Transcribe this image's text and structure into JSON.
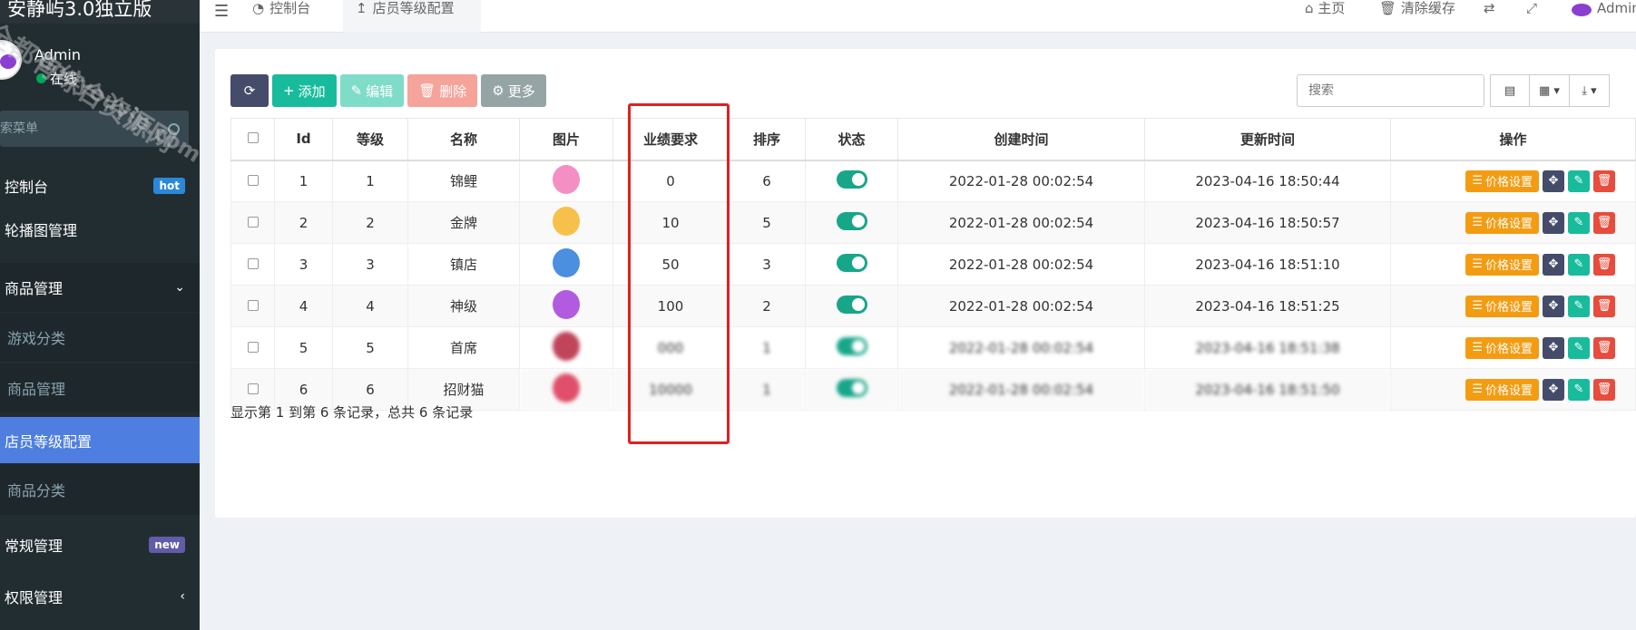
{
  "sidebar": {
    "brand": "安静屿3.0独立版",
    "user_name": "Admin",
    "user_status": "在线",
    "search_placeholder": "搜索菜单",
    "items": [
      {
        "label": "控制台",
        "badge": "hot"
      },
      {
        "label": "轮播图管理"
      },
      {
        "label": "商品管理"
      },
      {
        "label": "游戏分类"
      },
      {
        "label": "商品管理"
      },
      {
        "label": "店员等级配置"
      },
      {
        "label": "商品分类"
      },
      {
        "label": "常规管理",
        "badge": "new"
      },
      {
        "label": "权限管理"
      }
    ]
  },
  "watermark": {
    "line1": "全都有综合资源网",
    "line2": "douyouvip.com"
  },
  "header": {
    "menu_icon": "hamburger-icon",
    "tabs": [
      {
        "label": "控制台",
        "icon": "dashboard-icon"
      },
      {
        "label": "店员等级配置",
        "icon": "level-icon"
      }
    ],
    "home": "主页",
    "clear_cache": "清除缓存",
    "admin": "Admin"
  },
  "toolbar": {
    "refresh_icon": "refresh-icon",
    "add": "添加",
    "edit": "编辑",
    "delete": "删除",
    "more": "更多",
    "search_placeholder": "搜索"
  },
  "table": {
    "headers": [
      "Id",
      "等级",
      "名称",
      "图片",
      "业绩要求",
      "排序",
      "状态",
      "创建时间",
      "更新时间",
      "操作"
    ],
    "rows": [
      {
        "id": "1",
        "level": "1",
        "name": "锦鲤",
        "img_color": "#f48fc4",
        "requirement": "0",
        "sort": "6",
        "created": "2022-01-28 00:02:54",
        "updated": "2023-04-16 18:50:44"
      },
      {
        "id": "2",
        "level": "2",
        "name": "金牌",
        "img_color": "#f7c04a",
        "requirement": "10",
        "sort": "5",
        "created": "2022-01-28 00:02:54",
        "updated": "2023-04-16 18:50:57"
      },
      {
        "id": "3",
        "level": "3",
        "name": "镇店",
        "img_color": "#4a8fe0",
        "requirement": "50",
        "sort": "3",
        "created": "2022-01-28 00:02:54",
        "updated": "2023-04-16 18:51:10"
      },
      {
        "id": "4",
        "level": "4",
        "name": "神级",
        "img_color": "#b25be0",
        "requirement": "100",
        "sort": "2",
        "created": "2022-01-28 00:02:54",
        "updated": "2023-04-16 18:51:25"
      },
      {
        "id": "5",
        "level": "5",
        "name": "首席",
        "img_color": "#c0455a",
        "requirement": "000",
        "sort": "1",
        "created": "2022-01-28 00:02:54",
        "updated": "2023-04-16 18:51:38"
      },
      {
        "id": "6",
        "level": "6",
        "name": "招财猫",
        "img_color": "#e0506a",
        "requirement": "10000",
        "sort": "1",
        "created": "2022-01-28 00:02:54",
        "updated": "2023-04-16 18:51:50"
      }
    ],
    "price_label": "价格设置"
  },
  "footer": "显示第 1 到第 6 条记录，总共 6 条记录"
}
